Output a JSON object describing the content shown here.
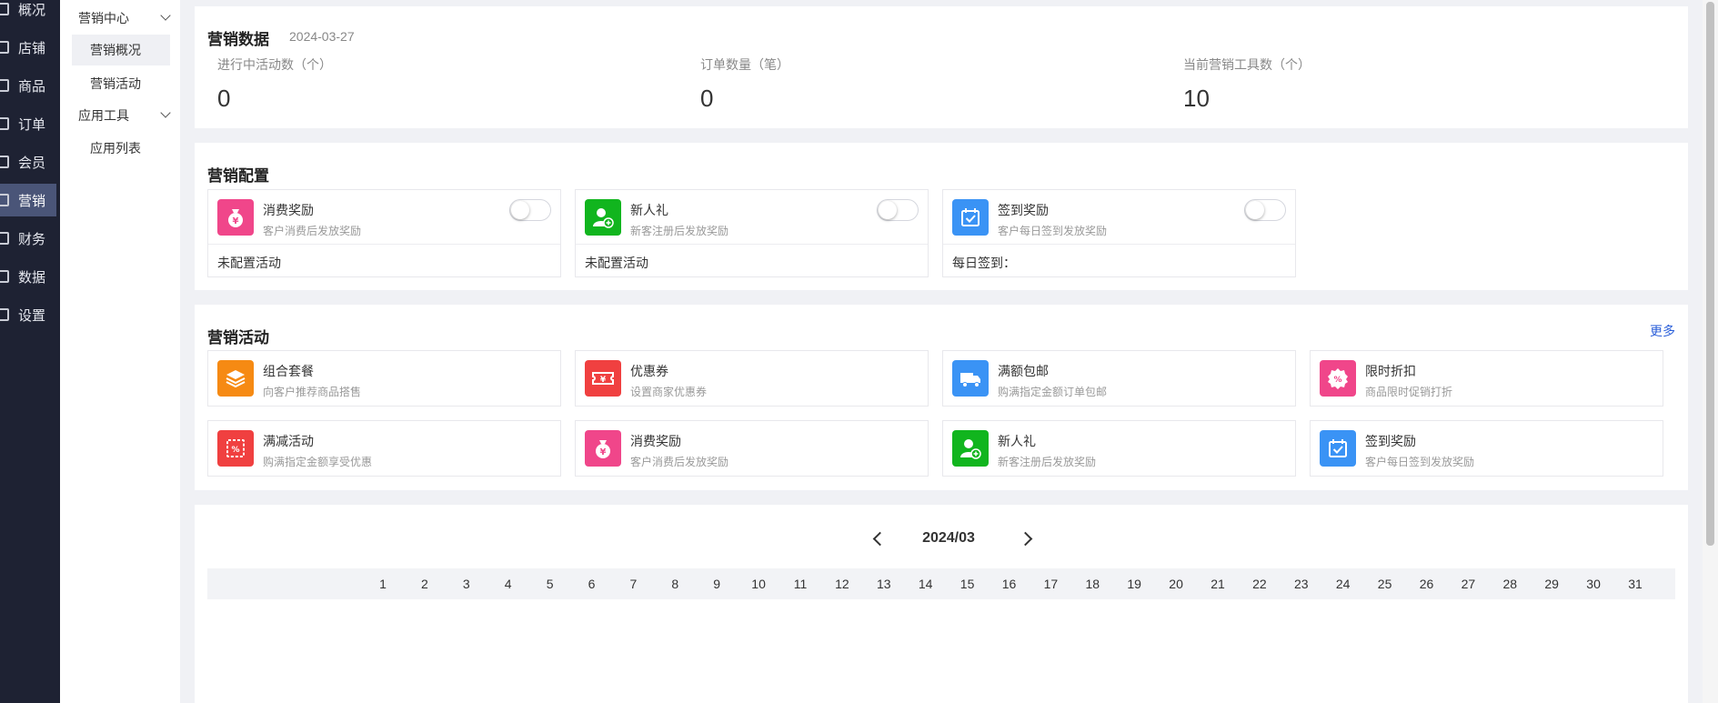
{
  "nav": {
    "items": [
      {
        "label": "概况",
        "active": false
      },
      {
        "label": "店铺",
        "active": false
      },
      {
        "label": "商品",
        "active": false
      },
      {
        "label": "订单",
        "active": false
      },
      {
        "label": "会员",
        "active": false
      },
      {
        "label": "营销",
        "active": true
      },
      {
        "label": "财务",
        "active": false
      },
      {
        "label": "数据",
        "active": false
      },
      {
        "label": "设置",
        "active": false
      }
    ]
  },
  "subnav": {
    "groups": [
      {
        "label": "营销中心",
        "items": [
          {
            "label": "营销概况",
            "active": true
          },
          {
            "label": "营销活动",
            "active": false
          }
        ]
      },
      {
        "label": "应用工具",
        "items": [
          {
            "label": "应用列表",
            "active": false
          }
        ]
      }
    ]
  },
  "stats_panel": {
    "title": "营销数据",
    "date": "2024-03-27",
    "stats": [
      {
        "label": "进行中活动数（个）",
        "value": "0"
      },
      {
        "label": "订单数量（笔）",
        "value": "0"
      },
      {
        "label": "当前营销工具数（个）",
        "value": "10"
      }
    ]
  },
  "config_panel": {
    "title": "营销配置",
    "cards": [
      {
        "name": "消费奖励",
        "desc": "客户消费后发放奖励",
        "status": "未配置活动",
        "icon": "money-bag-icon",
        "color": "#f0468a",
        "enabled": false
      },
      {
        "name": "新人礼",
        "desc": "新客注册后发放奖励",
        "status": "未配置活动",
        "icon": "new-user-icon",
        "color": "#11b51e",
        "enabled": false
      },
      {
        "name": "签到奖励",
        "desc": "客户每日签到发放奖励",
        "status": "每日签到：",
        "icon": "calendar-check-icon",
        "color": "#3a93f5",
        "enabled": false
      }
    ]
  },
  "activities_panel": {
    "title": "营销活动",
    "more_label": "更多",
    "cards": [
      {
        "name": "组合套餐",
        "desc": "向客户推荐商品搭售",
        "icon": "layers-icon",
        "color": "#f68a13"
      },
      {
        "name": "优惠券",
        "desc": "设置商家优惠券",
        "icon": "coupon-icon",
        "color": "#f04040"
      },
      {
        "name": "满额包邮",
        "desc": "购满指定金额订单包邮",
        "icon": "truck-icon",
        "color": "#3a93f5"
      },
      {
        "name": "限时折扣",
        "desc": "商品限时促销打折",
        "icon": "discount-badge-icon",
        "color": "#f0468a"
      },
      {
        "name": "满减活动",
        "desc": "购满指定金额享受优惠",
        "icon": "percent-ticket-icon",
        "color": "#f04040"
      },
      {
        "name": "消费奖励",
        "desc": "客户消费后发放奖励",
        "icon": "money-bag-icon",
        "color": "#f0468a"
      },
      {
        "name": "新人礼",
        "desc": "新客注册后发放奖励",
        "icon": "new-user-icon",
        "color": "#11b51e"
      },
      {
        "name": "签到奖励",
        "desc": "客户每日签到发放奖励",
        "icon": "calendar-check-icon",
        "color": "#3a93f5"
      }
    ]
  },
  "calendar": {
    "month": "2024/03",
    "days": [
      "1",
      "2",
      "3",
      "4",
      "5",
      "6",
      "7",
      "8",
      "9",
      "10",
      "11",
      "12",
      "13",
      "14",
      "15",
      "16",
      "17",
      "18",
      "19",
      "20",
      "21",
      "22",
      "23",
      "24",
      "25",
      "26",
      "27",
      "28",
      "29",
      "30",
      "31"
    ]
  }
}
